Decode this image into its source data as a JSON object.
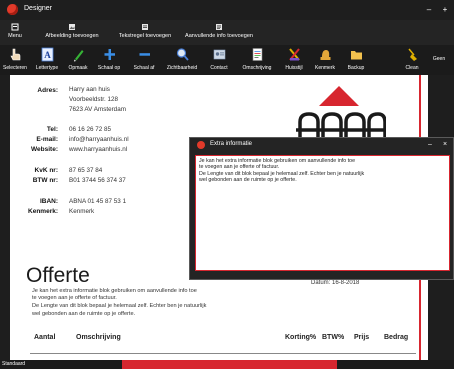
{
  "window": {
    "title": "Designer",
    "minimize": "–",
    "maximize": "+"
  },
  "toolbar1": {
    "items": [
      {
        "label": "Menu",
        "icon": "menu-icon"
      },
      {
        "label": "Afbeelding toevoegen",
        "icon": "image-add-icon"
      },
      {
        "label": "Tekstregel toevoegen",
        "icon": "text-line-add-icon"
      },
      {
        "label": "Aanvullende info toevoegen",
        "icon": "info-add-icon"
      }
    ]
  },
  "toolbar2": {
    "items": [
      {
        "label": "Selecteren",
        "icon": "pointer-icon"
      },
      {
        "label": "Lettertype",
        "icon": "font-icon"
      },
      {
        "label": "Opmaak",
        "icon": "pen-icon"
      },
      {
        "label": "Schaal op",
        "icon": "plus-icon"
      },
      {
        "label": "Schaal af",
        "icon": "minus-icon"
      },
      {
        "label": "Zichtbaarheid",
        "icon": "magnifier-icon"
      },
      {
        "label": "Contact",
        "icon": "contact-icon"
      },
      {
        "label": "Omschrijving",
        "icon": "description-icon"
      },
      {
        "label": "Huisstijl",
        "icon": "style-icon"
      },
      {
        "label": "Kenmerk",
        "icon": "feature-icon"
      },
      {
        "label": "Backup",
        "icon": "folder-icon"
      },
      {
        "label": "Clean",
        "icon": "broom-icon"
      },
      {
        "label": "Geen",
        "icon": ""
      }
    ]
  },
  "document": {
    "address_label": "Adres:",
    "address_lines": [
      "Harry aan huis",
      "Voorbeeldstr. 128",
      "7623 AV Amsterdam"
    ],
    "tel_label": "Tel:",
    "tel": "06 16 26 72 85",
    "email_label": "E-mail:",
    "email": "info@harryaanhuis.nl",
    "website_label": "Website:",
    "website": "www.harryaanhuis.nl",
    "kvk_label": "KvK nr:",
    "kvk": "87 65 37 84",
    "btw_label": "BTW nr:",
    "btw": "B01 3744 56 374 37",
    "iban_label": "IBAN:",
    "iban": "ABNA 01 45 87 53 1",
    "kenmerk_label": "Kenmerk:",
    "kenmerk": "Kenmerk",
    "title": "Offerte",
    "date": "Datum: 16-8-2018",
    "text_lines": [
      "Je kan het extra informatie blok gebruiken om aanvullende info toe",
      "te voegen aan je offerte of factuur.",
      "De Lengte van dit blok bepaal je helemaal zelf. Echter ben je natuurlijk",
      "wel gebonden aan de ruimte op je offerte."
    ],
    "columns": [
      "Aantal",
      "Omschrijving",
      "Korting%",
      "BTW%",
      "Prijs",
      "Bedrag"
    ]
  },
  "popup": {
    "title": "Extra informatie",
    "minimize": "–",
    "close": "×",
    "text_lines": [
      "Je kan het extra informatie blok gebruiken om aanvullende info toe",
      "te voegen aan je offerte of factuur.",
      "De Lengte van dit blok bepaal je helemaal zelf. Echter ben je natuurlijk",
      "wel gebonden aan de ruimte op je offerte."
    ]
  },
  "statusbar": {
    "text": "Standaard"
  },
  "colors": {
    "accent": "#d7262f",
    "dark": "#1e1e1e",
    "house": "#d7262f"
  }
}
